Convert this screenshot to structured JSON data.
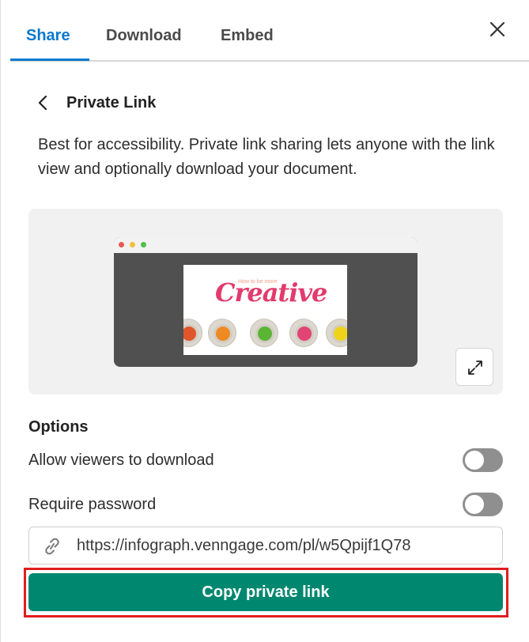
{
  "tabs": [
    {
      "label": "Share",
      "active": true
    },
    {
      "label": "Download",
      "active": false
    },
    {
      "label": "Embed",
      "active": false
    }
  ],
  "header": {
    "title": "Private Link",
    "description": "Best for accessibility. Private link sharing lets anyone with the link view and optionally download your document."
  },
  "preview": {
    "doc_subtitle": "How to be more",
    "doc_title": "Creative",
    "plant_colors": [
      "#e0552a",
      "#ef8a22",
      "#5bb534",
      "#e24474",
      "#f0d21a"
    ]
  },
  "options": {
    "heading": "Options",
    "allow_download": {
      "label": "Allow viewers to download",
      "enabled": false
    },
    "require_password": {
      "label": "Require password",
      "enabled": false
    }
  },
  "link": {
    "url": "https://infograph.venngage.com/pl/w5Qpijf1Q78",
    "copy_label": "Copy private link"
  },
  "colors": {
    "accent": "#0b79d0",
    "primary_button": "#00876f",
    "highlight": "#e01e1e"
  }
}
